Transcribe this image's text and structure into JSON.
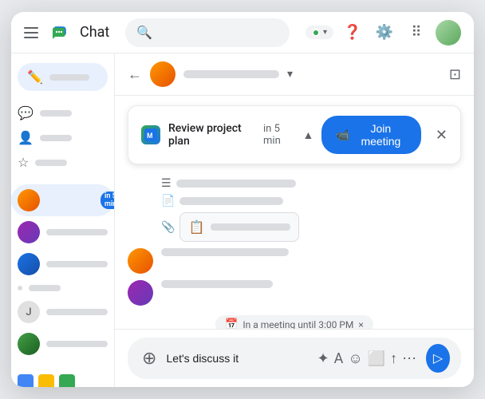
{
  "window": {
    "title": "Chat"
  },
  "topbar": {
    "app_name": "Chat",
    "search_placeholder": "Search",
    "status": "active",
    "status_color": "#34a853"
  },
  "sidebar": {
    "new_chat_label": "",
    "nav_items": [
      {
        "id": "chat",
        "icon": "💬"
      },
      {
        "id": "rooms",
        "icon": "🏠"
      },
      {
        "id": "meet",
        "icon": "📹"
      }
    ],
    "chat_items": [
      {
        "id": "item1",
        "active": true,
        "has_badge": true,
        "badge_text": "in 5 min",
        "has_meet": true
      },
      {
        "id": "item2",
        "active": false
      },
      {
        "id": "item3",
        "active": false
      },
      {
        "id": "item4",
        "active": false,
        "is_letter": true,
        "letter": "J"
      },
      {
        "id": "item5",
        "active": false
      }
    ]
  },
  "chat": {
    "meeting_banner": {
      "title": "Review project plan",
      "time_label": "in 5 min",
      "join_button": "Join meeting",
      "expand_icon": "▲"
    },
    "input": {
      "placeholder": "Let's discuss it",
      "value": "Let's discuss it"
    },
    "meeting_status": {
      "label": "In a meeting until 3:00 PM",
      "close": "×"
    }
  }
}
